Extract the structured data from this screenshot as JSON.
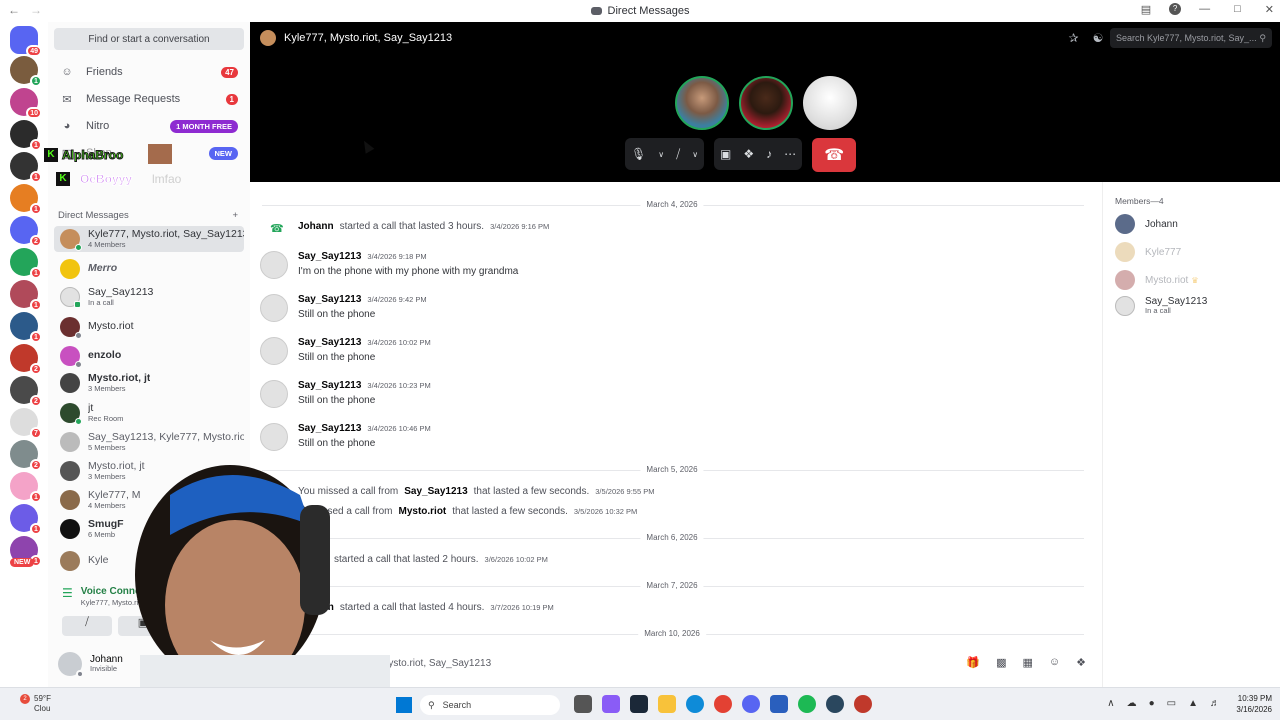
{
  "window": {
    "title": "Direct Messages"
  },
  "sidebar": {
    "find_label": "Find or start a conversation",
    "nav": [
      {
        "label": "Friends",
        "badge": "47"
      },
      {
        "label": "Message Requests",
        "badge": "1"
      },
      {
        "label": "Nitro",
        "pill": "1 MONTH FREE"
      },
      {
        "label": "Shop",
        "pill": "NEW"
      }
    ],
    "overlay_names": [
      "AlphaBroo",
      "OeBoyyy",
      "lmfao"
    ],
    "dm_header": "Direct Messages",
    "dms": [
      {
        "name": "Kyle777, Mysto.riot, Say_Say1213",
        "sub": "4 Members"
      },
      {
        "name": "Merro",
        "sub": ""
      },
      {
        "name": "Say_Say1213",
        "sub": "In a call"
      },
      {
        "name": "Mysto.riot",
        "sub": ""
      },
      {
        "name": "enzolo",
        "sub": ""
      },
      {
        "name": "Mysto.riot, jt",
        "sub": "3 Members"
      },
      {
        "name": "jt",
        "sub": "Rec Room"
      },
      {
        "name": "Say_Say1213, Kyle777, Mysto.rio...",
        "sub": "5 Members"
      },
      {
        "name": "Mysto.riot, jt",
        "sub": "3 Members"
      },
      {
        "name": "Kyle777, M",
        "sub": "4 Members"
      },
      {
        "name": "SmugF",
        "sub": "6 Memb"
      },
      {
        "name": "Kyle",
        "sub": ""
      }
    ],
    "voice": {
      "status": "Voice Connected",
      "channel": "Kyle777, Mysto.riot, Say_"
    },
    "user": {
      "name": "Johann",
      "status": "Invisible"
    },
    "server_badges": [
      "49",
      "1",
      "10",
      "1",
      "1",
      "1",
      "2",
      "1",
      "1",
      "1",
      "2",
      "2",
      "7",
      "2",
      "1",
      "1",
      "1",
      "1",
      "NEW"
    ]
  },
  "call": {
    "title": "Kyle777, Mysto.riot, Say_Say1213",
    "search_placeholder": "Search Kyle777, Mysto.riot, Say_..."
  },
  "chat": {
    "dates": [
      "March 4, 2026",
      "March 5, 2026",
      "March 6, 2026",
      "March 7, 2026",
      "March 10, 2026"
    ],
    "call_log_1": {
      "user": "Johann",
      "text": "started a call that lasted 3 hours.",
      "time": "3/4/2026 9:16 PM"
    },
    "messages": [
      {
        "author": "Say_Say1213",
        "time": "3/4/2026 9:18 PM",
        "text": "I'm on the phone with my phone with my grandma"
      },
      {
        "author": "Say_Say1213",
        "time": "3/4/2026 9:42 PM",
        "text": "Still on the phone"
      },
      {
        "author": "Say_Say1213",
        "time": "3/4/2026 10:02 PM",
        "text": "Still on the phone"
      },
      {
        "author": "Say_Say1213",
        "time": "3/4/2026 10:23 PM",
        "text": "Still on the phone"
      },
      {
        "author": "Say_Say1213",
        "time": "3/4/2026 10:46 PM",
        "text": "Still on the phone"
      }
    ],
    "missed": [
      {
        "pre": "You missed a call from",
        "user": "Say_Say1213",
        "post": "that lasted a few seconds.",
        "time": "3/5/2026 9:55 PM"
      },
      {
        "pre": "ou missed a call from",
        "user": "Mysto.riot",
        "post": "that lasted a few seconds.",
        "time": "3/5/2026 10:32 PM"
      }
    ],
    "call_log_2": {
      "text": "started a call that lasted 2 hours.",
      "time": "3/6/2026 10:02 PM"
    },
    "call_log_3": {
      "user": "hann",
      "text": "started a call that lasted 4 hours.",
      "time": "3/7/2026 10:19 PM"
    },
    "input_placeholder": "Mysto.riot, Say_Say1213"
  },
  "members": {
    "header": "Members—4",
    "list": [
      {
        "name": "Johann",
        "sub": ""
      },
      {
        "name": "Kyle777",
        "sub": ""
      },
      {
        "name": "Mysto.riot",
        "sub": ""
      },
      {
        "name": "Say_Say1213",
        "sub": "In a call"
      }
    ]
  },
  "taskbar": {
    "temp": "59°F",
    "cond": "Clou",
    "search": "Search",
    "time": "10:39 PM",
    "date": "3/16/2026",
    "weather_badge": "2"
  }
}
